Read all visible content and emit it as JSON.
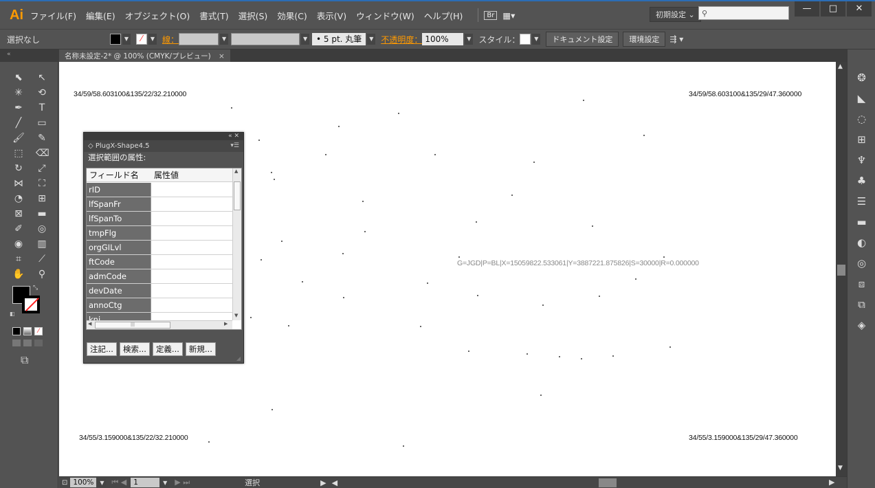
{
  "app": {
    "logo": "Ai",
    "menus": [
      "ファイル(F)",
      "編集(E)",
      "オブジェクト(O)",
      "書式(T)",
      "選択(S)",
      "効果(C)",
      "表示(V)",
      "ウィンドウ(W)",
      "ヘルプ(H)"
    ],
    "bridge_badge": "Br",
    "workspace": "初期設定 ⌄",
    "search_placeholder": ""
  },
  "window_controls": {
    "minimize": "—",
    "maximize": "□",
    "close": "✕"
  },
  "controlbar": {
    "selection_status": "選択なし",
    "stroke_label": "線：",
    "brush": "• 5 pt. 丸筆",
    "opacity_label": "不透明度：",
    "opacity_value": "100%",
    "style_label": "スタイル：",
    "document_setup": "ドキュメント設定",
    "preferences": "環境設定",
    "colors": {
      "accent": "#ff9a00",
      "fill": "#000000",
      "stroke_none": "#ff3333"
    }
  },
  "document": {
    "tab_title": "名称未設定-2* @ 100% (CMYK/プレビュー)",
    "tab_close": "×"
  },
  "canvas": {
    "corner_top_left": "34/59/58.603100&135/22/32.210000",
    "corner_top_right": "34/59/58.603100&135/29/47.360000",
    "corner_bottom_left": "34/55/3.159000&135/22/32.210000",
    "corner_bottom_right": "34/55/3.159000&135/29/47.360000",
    "annotation": "G=JGD|P=BL|X=15059822.533061|Y=3887221.875826|S=30000|R=0.000000"
  },
  "plugx_panel": {
    "tab_title": "◇ PlugX-Shape4.5",
    "heading": "選択範囲の属性:",
    "col_field": "フィールド名",
    "col_value": "属性値",
    "fields": [
      "rID",
      "lfSpanFr",
      "lfSpanTo",
      "tmpFlg",
      "orgGILvl",
      "ftCode",
      "admCode",
      "devDate",
      "annoCtg",
      "knj"
    ],
    "buttons": [
      "注記...",
      "検索...",
      "定義...",
      "新規..."
    ]
  },
  "statusbar": {
    "zoom": "100%",
    "page": "1",
    "tool": "選択"
  }
}
